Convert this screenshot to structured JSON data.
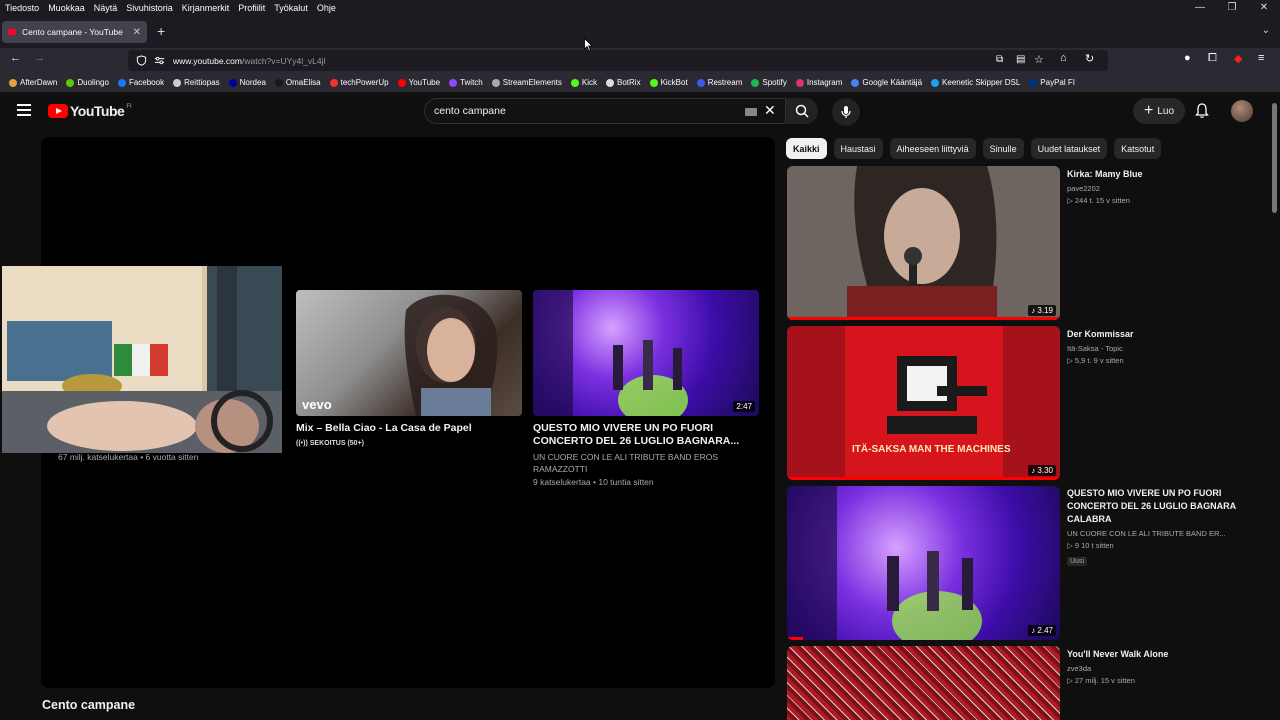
{
  "menubar": {
    "items": [
      "Tiedosto",
      "Muokkaa",
      "Näytä",
      "Sivuhistoria",
      "Kirjanmerkit",
      "Profiilit",
      "Työkalut",
      "Ohje"
    ]
  },
  "tab": {
    "title": "Cento campane - YouTube"
  },
  "address": {
    "host": "www.youtube.com",
    "path": "/watch?v=UYy4l_vL4jI"
  },
  "bookmarks": [
    {
      "label": "AfterDawn",
      "color": "#e0a23a"
    },
    {
      "label": "Duolingo",
      "color": "#58cc02"
    },
    {
      "label": "Facebook",
      "color": "#1877f2"
    },
    {
      "label": "Reittiopas",
      "color": "#cccccc"
    },
    {
      "label": "Nordea",
      "color": "#0000a0"
    },
    {
      "label": "OmaElisa",
      "color": "#1a1a1a"
    },
    {
      "label": "techPowerUp",
      "color": "#e33"
    },
    {
      "label": "YouTube",
      "color": "#ff0000"
    },
    {
      "label": "Twitch",
      "color": "#9146ff"
    },
    {
      "label": "StreamElements",
      "color": "#aaaaaa"
    },
    {
      "label": "Kick",
      "color": "#53fc18"
    },
    {
      "label": "BotRix",
      "color": "#dddddd"
    },
    {
      "label": "KickBot",
      "color": "#53fc18"
    },
    {
      "label": "Restream",
      "color": "#3f5be5"
    },
    {
      "label": "Spotify",
      "color": "#1db954"
    },
    {
      "label": "Instagram",
      "color": "#e1306c"
    },
    {
      "label": "Google Kääntäjä",
      "color": "#4285f4"
    },
    {
      "label": "Keenetic Skipper DSL",
      "color": "#1da1f2"
    },
    {
      "label": "PayPal FI",
      "color": "#003087"
    }
  ],
  "youtube": {
    "logo_text": "YouTube",
    "region": "FI",
    "search_value": "cento campane",
    "create_label": "Luo"
  },
  "endscreen": {
    "webcam_views": "67 milj. katselukertaa • 6 vuotta sitten",
    "card1": {
      "title": "Mix – Bella Ciao - La Casa de Papel",
      "sub": "SEKOITUS (50+)",
      "brand": "vevo"
    },
    "card2": {
      "title": "QUESTO MIO VIVERE UN PO FUORI CONCERTO DEL 26 LUGLIO BAGNARA...",
      "channel": "UN CUORE CON LE ALI TRIBUTE BAND EROS RAMAZZOTTI",
      "meta": "9 katselukertaa • 10 tuntia sitten",
      "duration": "2:47"
    }
  },
  "video_title": "Cento campane",
  "chips": [
    "Kaikki",
    "Haustasi",
    "Aiheeseen liittyviä",
    "Sinulle",
    "Uudet lataukset",
    "Katsotut"
  ],
  "recommendations": [
    {
      "title": "Kirka: Mamy Blue",
      "channel": "pave2202",
      "meta": "▷ 244 t.   15 v sitten",
      "duration": "3.19",
      "badge": ""
    },
    {
      "title": "Der Kommissar",
      "channel": "Itä-Saksa - Topic",
      "meta": "▷ 5,9 t.   9 v sitten",
      "duration": "3.30",
      "badge": "",
      "thumb_caption": "ITÄ-SAKSA   MAN THE MACHINES"
    },
    {
      "title": "QUESTO MIO VIVERE UN PO  FUORI CONCERTO DEL 26 LUGLIO BAGNARA CALABRA",
      "channel": "UN CUORE CON LE ALI TRIBUTE BAND ER...",
      "meta": "▷ 9   10 t sitten",
      "duration": "2.47",
      "badge": "Uusi"
    },
    {
      "title": "You'll Never Walk Alone",
      "channel": "zve3da",
      "meta": "▷ 27 milj.   15 v sitten",
      "duration": "",
      "badge": ""
    }
  ]
}
